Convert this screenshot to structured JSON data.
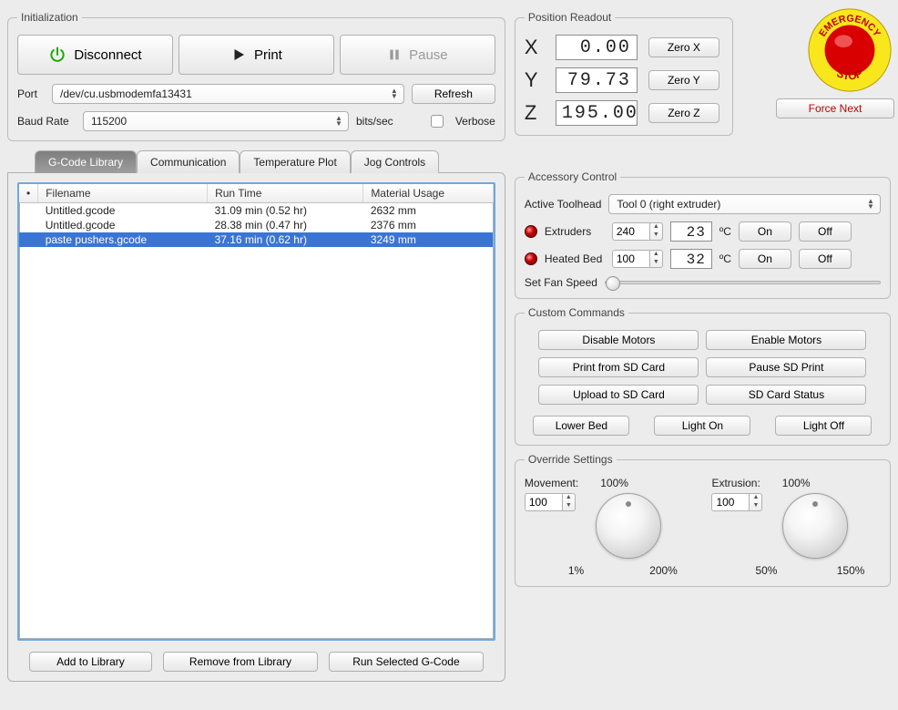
{
  "initialization": {
    "legend": "Initialization",
    "disconnect": "Disconnect",
    "print": "Print",
    "pause": "Pause",
    "port_label": "Port",
    "port_value": "/dev/cu.usbmodemfa13431",
    "refresh": "Refresh",
    "baud_label": "Baud Rate",
    "baud_value": "115200",
    "baud_units": "bits/sec",
    "verbose_label": "Verbose"
  },
  "tabs": {
    "gcode_library": "G-Code Library",
    "communication": "Communication",
    "temperature_plot": "Temperature Plot",
    "jog_controls": "Jog Controls"
  },
  "table": {
    "h_filename": "Filename",
    "h_runtime": "Run Time",
    "h_material": "Material Usage",
    "rows": [
      {
        "filename": "Untitled.gcode",
        "runtime": "31.09 min (0.52 hr)",
        "material": "2632 mm"
      },
      {
        "filename": "Untitled.gcode",
        "runtime": "28.38 min (0.47 hr)",
        "material": "2376 mm"
      },
      {
        "filename": "paste pushers.gcode",
        "runtime": "37.16 min (0.62 hr)",
        "material": "3249 mm"
      }
    ],
    "selected_index": 2
  },
  "library_buttons": {
    "add": "Add to Library",
    "remove": "Remove from Library",
    "run": "Run Selected G-Code"
  },
  "position": {
    "legend": "Position Readout",
    "x_label": "X",
    "x_value": "0.00",
    "x_zero": "Zero X",
    "y_label": "Y",
    "y_value": "79.73",
    "y_zero": "Zero Y",
    "z_label": "Z",
    "z_value": "195.00",
    "z_zero": "Zero Z"
  },
  "estop_text": "EMERGENCY STOP",
  "force_next": "Force Next",
  "accessory": {
    "legend": "Accessory Control",
    "active_toolhead_label": "Active Toolhead",
    "active_toolhead_value": "Tool 0 (right extruder)",
    "extruders_label": "Extruders",
    "extruders_set": "240",
    "extruders_actual": "23",
    "degc": "ºC",
    "on": "On",
    "off": "Off",
    "bed_label": "Heated Bed",
    "bed_set": "100",
    "bed_actual": "32",
    "fan_label": "Set Fan Speed"
  },
  "commands": {
    "legend": "Custom Commands",
    "disable_motors": "Disable Motors",
    "enable_motors": "Enable Motors",
    "print_from_sd": "Print from SD Card",
    "pause_sd": "Pause SD Print",
    "upload_sd": "Upload to SD Card",
    "sd_status": "SD Card Status",
    "lower_bed": "Lower Bed",
    "light_on": "Light On",
    "light_off": "Light Off"
  },
  "override": {
    "legend": "Override Settings",
    "movement_label": "Movement:",
    "movement_pct": "100%",
    "movement_val": "100",
    "movement_min": "1%",
    "movement_max": "200%",
    "extrusion_label": "Extrusion:",
    "extrusion_pct": "100%",
    "extrusion_val": "100",
    "extrusion_min": "50%",
    "extrusion_max": "150%"
  }
}
